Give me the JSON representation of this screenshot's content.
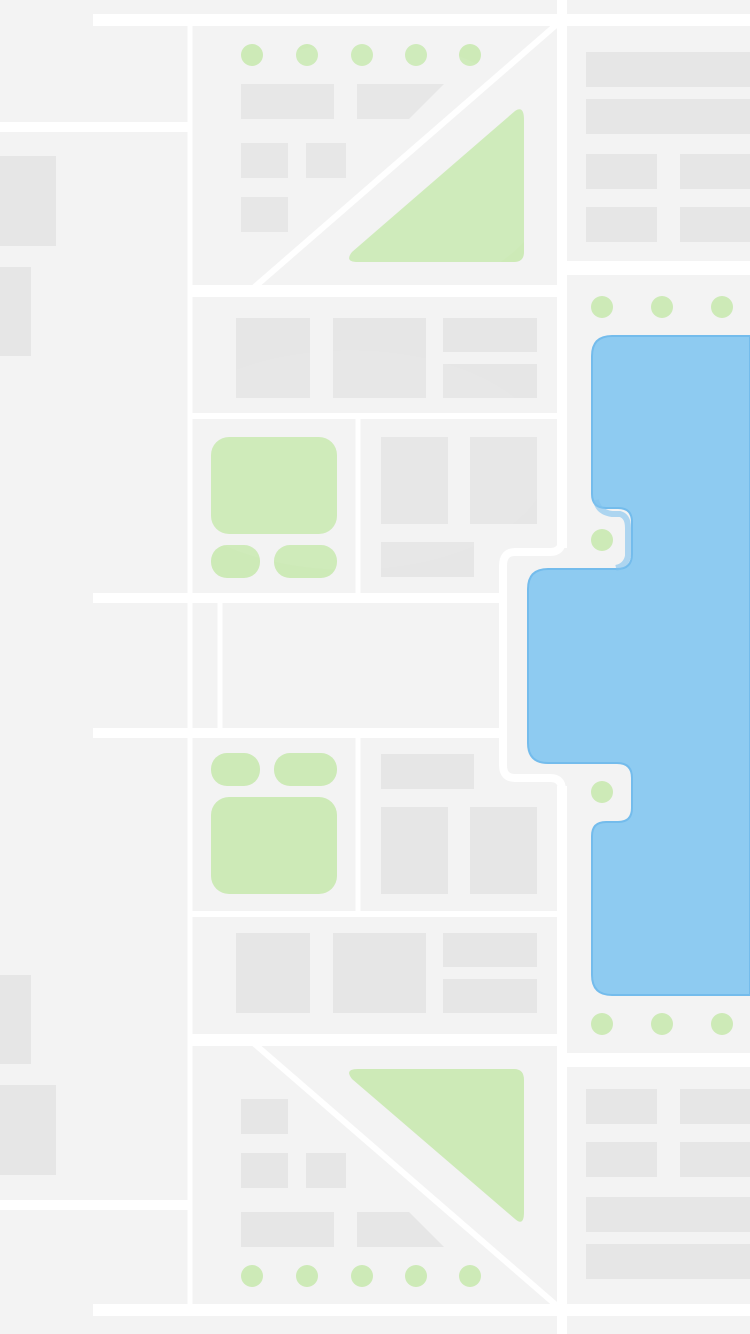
{
  "map": {
    "colors": {
      "ground": "#f3f3f3",
      "road": "#ffffff",
      "building": "#e6e6e6",
      "park": "#cdeab7",
      "tree": "#cdeab7",
      "water": "#8ecbf1",
      "water_edge": "#6db6ea"
    },
    "features": {
      "roads": "white-street-grid",
      "buildings": "gray-blocks",
      "parks": "green-areas",
      "trees": "green-dots",
      "water": "blue-lake"
    }
  }
}
